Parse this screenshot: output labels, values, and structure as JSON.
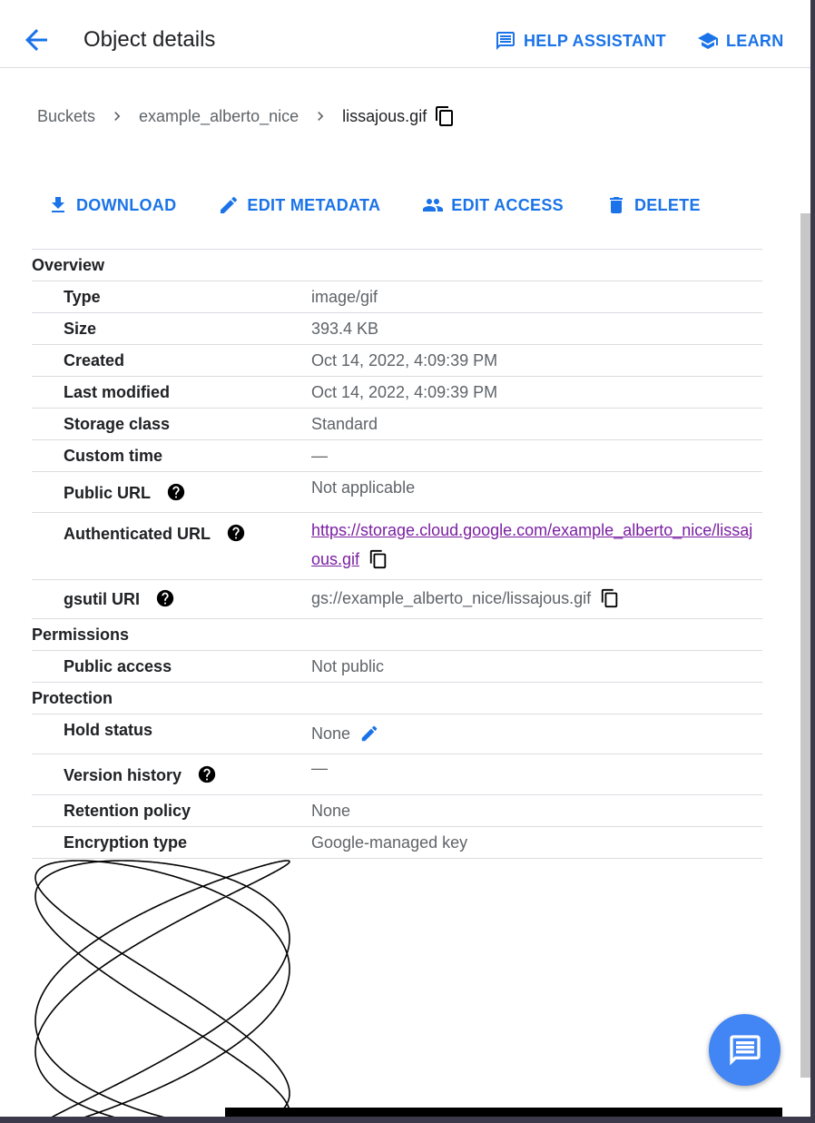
{
  "header": {
    "title": "Object details",
    "help_assistant": "HELP ASSISTANT",
    "learn": "LEARN"
  },
  "breadcrumb": {
    "items": [
      "Buckets",
      "example_alberto_nice"
    ],
    "current": "lissajous.gif"
  },
  "actions": {
    "download": "DOWNLOAD",
    "edit_metadata": "EDIT METADATA",
    "edit_access": "EDIT ACCESS",
    "delete": "DELETE"
  },
  "overview": {
    "heading": "Overview",
    "type": {
      "label": "Type",
      "value": "image/gif"
    },
    "size": {
      "label": "Size",
      "value": "393.4 KB"
    },
    "created": {
      "label": "Created",
      "value": "Oct 14, 2022, 4:09:39 PM"
    },
    "last_modified": {
      "label": "Last modified",
      "value": "Oct 14, 2022, 4:09:39 PM"
    },
    "storage_class": {
      "label": "Storage class",
      "value": "Standard"
    },
    "custom_time": {
      "label": "Custom time",
      "value": "—"
    },
    "public_url": {
      "label": "Public URL",
      "value": "Not applicable"
    },
    "authenticated_url": {
      "label": "Authenticated URL",
      "value": "https://storage.cloud.google.com/example_alberto_nice/lissajous.gif"
    },
    "gsutil_uri": {
      "label": "gsutil URI",
      "value": "gs://example_alberto_nice/lissajous.gif"
    }
  },
  "permissions": {
    "heading": "Permissions",
    "public_access": {
      "label": "Public access",
      "value": "Not public"
    }
  },
  "protection": {
    "heading": "Protection",
    "hold_status": {
      "label": "Hold status",
      "value": "None"
    },
    "version_history": {
      "label": "Version history",
      "value": "—"
    },
    "retention_policy": {
      "label": "Retention policy",
      "value": "None"
    },
    "encryption_type": {
      "label": "Encryption type",
      "value": "Google-managed key"
    }
  },
  "colors": {
    "accent": "#1a73e8",
    "link_visited": "#7b1fa2",
    "fab": "#4285f4",
    "divider": "#dadce0"
  },
  "icons": {
    "back": "arrow-back-icon",
    "help_assistant": "feedback-icon",
    "learn": "school-icon",
    "copy": "copy-icon",
    "download": "download-icon",
    "edit": "pencil-icon",
    "access": "people-icon",
    "delete": "trash-icon",
    "help": "help-circle-icon",
    "fab": "chat-icon"
  }
}
